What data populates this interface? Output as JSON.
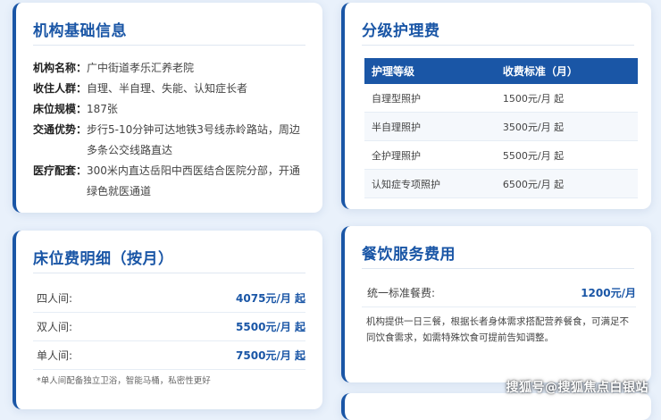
{
  "basic_info": {
    "title": "机构基础信息",
    "rows": [
      {
        "key": "机构名称：",
        "value": "广中街道孝乐汇养老院"
      },
      {
        "key": "收住人群：",
        "value": "自理、半自理、失能、认知症长者"
      },
      {
        "key": "床位规模：",
        "value": "187张"
      },
      {
        "key": "交通优势：",
        "value": "步行5-10分钟可达地铁3号线赤岭路站，周边多条公交线路直达"
      },
      {
        "key": "医疗配套：",
        "value": "300米内直达岳阳中西医结合医院分部，开通绿色就医通道"
      }
    ]
  },
  "care_fees": {
    "title": "分级护理费",
    "headers": [
      "护理等级",
      "收费标准（月）"
    ],
    "rows": [
      [
        "自理型照护",
        "1500元/月 起"
      ],
      [
        "半自理照护",
        "3500元/月 起"
      ],
      [
        "全护理照护",
        "5500元/月 起"
      ],
      [
        "认知症专项照护",
        "6500元/月 起"
      ]
    ]
  },
  "bed_fees": {
    "title": "床位费明细（按月）",
    "rows": [
      {
        "label": "四人间:",
        "price": "4075元/月 起"
      },
      {
        "label": "双人间:",
        "price": "5500元/月 起"
      },
      {
        "label": "单人间:",
        "price": "7500元/月 起"
      }
    ],
    "note": "*单人间配备独立卫浴，智能马桶，私密性更好"
  },
  "food_fees": {
    "title": "餐饮服务费用",
    "label": "统一标准餐费:",
    "price": "1200元/月",
    "desc": "机构提供一日三餐，根据长者身体需求搭配营养餐食，可满足不同饮食需求，如需特殊饮食可提前告知调整。"
  },
  "watermark": "搜狐号@搜狐焦点白银站"
}
